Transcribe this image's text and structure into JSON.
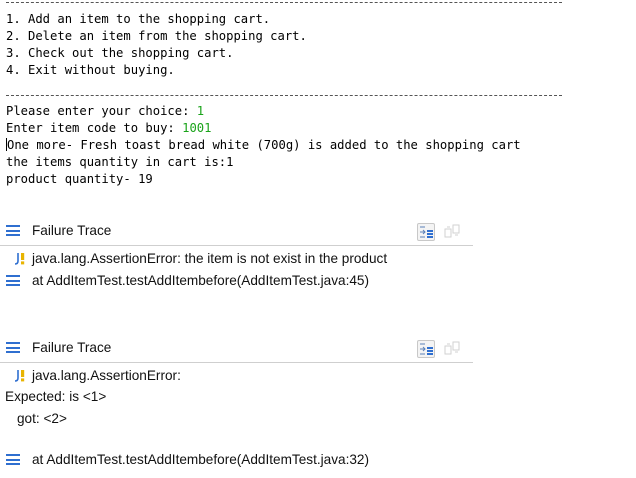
{
  "console": {
    "lines": [
      "1. Add an item to the shopping cart.",
      "2. Delete an item from the shopping cart.",
      "3. Check out the shopping cart.",
      "4. Exit without buying."
    ],
    "prompt_choice": "Please enter your choice: ",
    "choice_value": "1",
    "prompt_code": "Enter item code to buy: ",
    "code_value": "1001",
    "added_message": "One more- Fresh toast bread white (700g) is added to the shopping cart",
    "quantity_in_cart": "the items quantity in cart is:1",
    "product_quantity": "product quantity- 19"
  },
  "trace1": {
    "header": "Failure Trace",
    "error": "java.lang.AssertionError: the item is not exist in the product",
    "at": "at AddItemTest.testAddItembefore(AddItemTest.java:45)"
  },
  "trace2": {
    "header": "Failure Trace",
    "error": "java.lang.AssertionError:",
    "expected": "Expected: is <1>",
    "got": "got: <2>",
    "at": "at AddItemTest.testAddItembefore(AddItemTest.java:32)"
  },
  "icons": {
    "stack": "hamburger-stack-icon",
    "junit_error": "junit-error-icon",
    "filter": "filter-stack-trace-icon",
    "compare": "compare-result-icon"
  },
  "colors": {
    "input_green": "#1aa31a",
    "stack_icon_blue": "#2f6fd0"
  }
}
